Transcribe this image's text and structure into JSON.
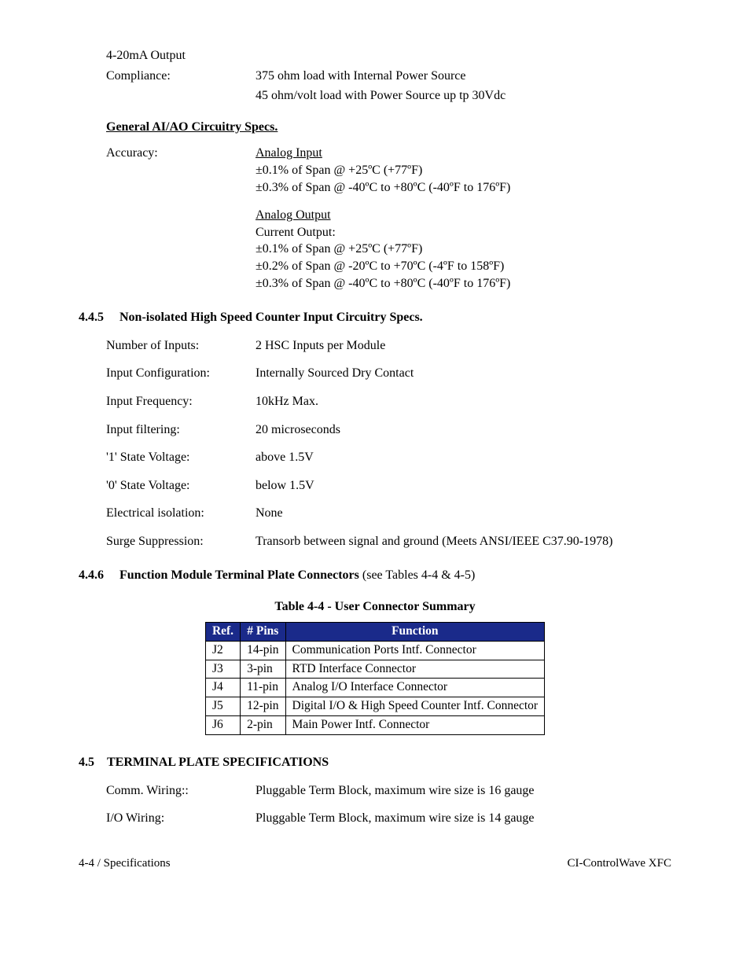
{
  "output": {
    "label1": "4-20mA Output",
    "label2": "Compliance:",
    "value1": "375 ohm load with Internal Power Source",
    "value2": "45 ohm/volt load with Power Source up tp 30Vdc"
  },
  "general_heading": "General AI/AO Circuitry Specs.",
  "accuracy": {
    "label": "Accuracy:",
    "ai_title": "Analog Input",
    "ai_l1": "±0.1% of Span @ +25ºC (+77ºF)",
    "ai_l2": "±0.3% of Span @ -40ºC to +80ºC (-40ºF to 176ºF)",
    "ao_title": "Analog Output",
    "ao_sub": "Current Output:",
    "ao_l1": "±0.1% of Span @ +25ºC (+77ºF)",
    "ao_l2": "±0.2% of Span @ -20ºC to +70ºC (-4ºF to 158ºF)",
    "ao_l3": "±0.3% of Span @ -40ºC to +80ºC (-40ºF to 176ºF)"
  },
  "s445": {
    "num": "4.4.5",
    "title": "Non-isolated High Speed Counter Input Circuitry Specs.",
    "rows": [
      {
        "label": "Number of Inputs:",
        "value": "2 HSC Inputs per Module"
      },
      {
        "label": "Input Configuration:",
        "value": "Internally Sourced Dry Contact"
      },
      {
        "label": "Input Frequency:",
        "value": "10kHz Max."
      },
      {
        "label": "Input filtering:",
        "value": "20 microseconds"
      },
      {
        "label": "'1' State Voltage:",
        "value": "above 1.5V"
      },
      {
        "label": "'0' State Voltage:",
        "value": "below 1.5V"
      },
      {
        "label": "Electrical isolation:",
        "value": "None"
      },
      {
        "label": "Surge Suppression:",
        "value": "Transorb between signal and ground (Meets ANSI/IEEE C37.90-1978)"
      }
    ]
  },
  "s446": {
    "num": "4.4.6",
    "title": "Function Module Terminal Plate Connectors",
    "note": " (see Tables 4-4 & 4-5)"
  },
  "table": {
    "caption": "Table 4-4 - User Connector Summary",
    "headers": [
      "Ref.",
      "# Pins",
      "Function"
    ],
    "rows": [
      [
        "J2",
        "14-pin",
        "Communication Ports Intf. Connector"
      ],
      [
        "J3",
        "3-pin",
        "RTD Interface Connector"
      ],
      [
        "J4",
        "11-pin",
        "Analog I/O Interface Connector"
      ],
      [
        "J5",
        "12-pin",
        "Digital I/O & High Speed Counter Intf. Connector"
      ],
      [
        "J6",
        "2-pin",
        "Main Power Intf. Connector"
      ]
    ]
  },
  "s45": {
    "num": "4.5",
    "title": "TERMINAL PLATE SPECIFICATIONS",
    "rows": [
      {
        "label": "Comm. Wiring::",
        "value": "Pluggable Term Block, maximum wire size is 16 gauge"
      },
      {
        "label": "I/O Wiring:",
        "value": "Pluggable Term Block, maximum wire size is 14 gauge"
      }
    ]
  },
  "footer": {
    "left": "4-4 / Specifications",
    "right": "CI-ControlWave XFC"
  }
}
